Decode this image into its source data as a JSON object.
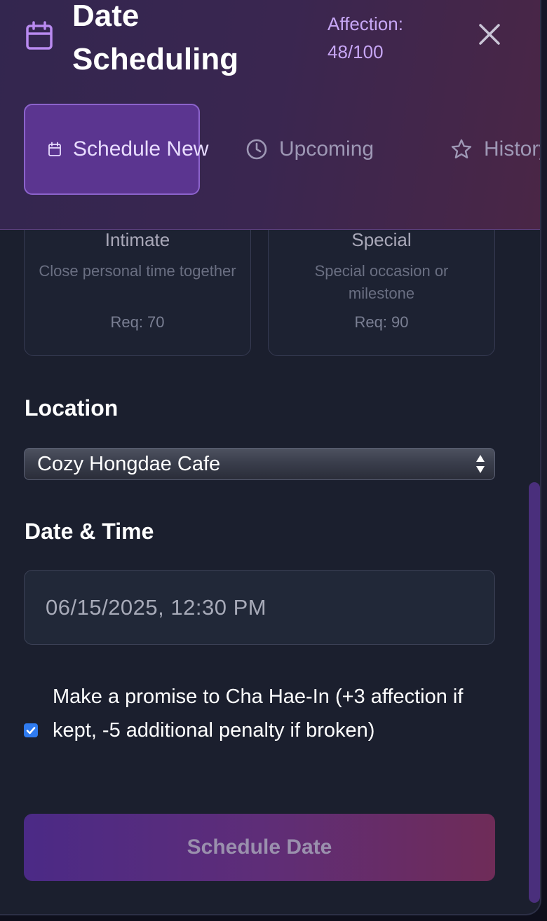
{
  "header": {
    "title": "Date Scheduling",
    "affection": "Affection: 48/100"
  },
  "tabs": [
    {
      "label": "Schedule New",
      "icon": "calendar-icon",
      "active": true
    },
    {
      "label": "Upcoming",
      "icon": "clock-icon",
      "active": false
    },
    {
      "label": "History",
      "icon": "star-icon",
      "active": false
    }
  ],
  "date_types": [
    {
      "title": "Intimate",
      "description": "Close personal time together",
      "requirement": "Req: 70"
    },
    {
      "title": "Special",
      "description": "Special occasion or milestone",
      "requirement": "Req: 90"
    }
  ],
  "location": {
    "label": "Location",
    "selected": "Cozy Hongdae Cafe"
  },
  "datetime": {
    "label": "Date & Time",
    "value": "06/15/2025, 12:30 PM"
  },
  "promise": {
    "checked": true,
    "text": "Make a promise to Cha Hae-In (+3 affection if kept, -5 additional penalty if broken)"
  },
  "submit": {
    "label": "Schedule Date"
  },
  "colors": {
    "accent": "#8c63cc",
    "panel": "#1b1f2e",
    "checkbox": "#2f7bf0"
  }
}
